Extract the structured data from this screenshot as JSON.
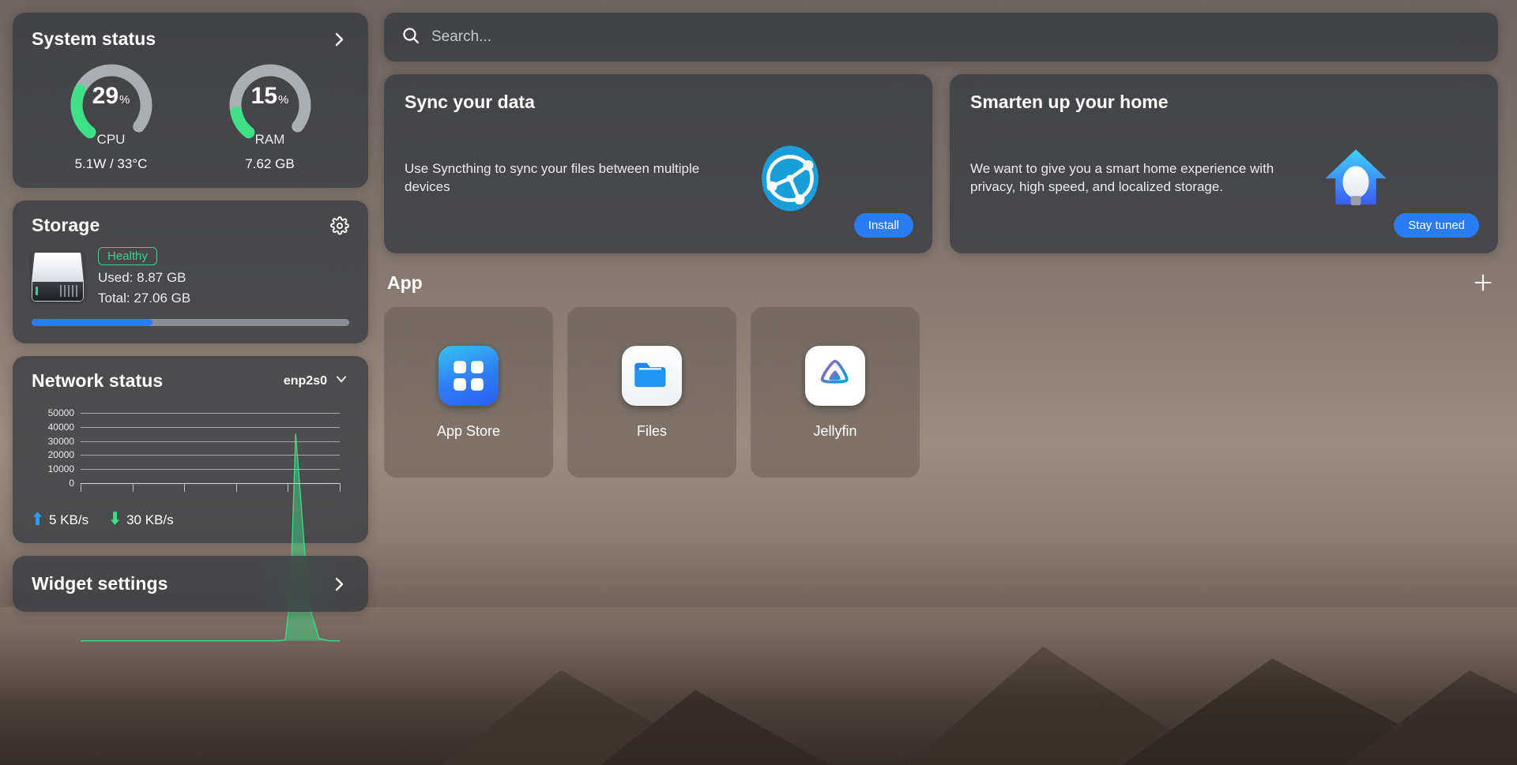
{
  "system_status": {
    "title": "System status",
    "chevron_icon": "chevron-right-icon",
    "cpu": {
      "value": "29",
      "percent_symbol": "%",
      "label": "CPU",
      "sub": "5.1W / 33°C",
      "percent": 29
    },
    "ram": {
      "value": "15",
      "percent_symbol": "%",
      "label": "RAM",
      "sub": "7.62 GB",
      "percent": 15
    },
    "gauge_color": "#3ee08a",
    "gauge_track_color": "#a9aeb3"
  },
  "storage": {
    "title": "Storage",
    "gear_icon": "gear-icon",
    "disk_icon": "hard-disk-icon",
    "status_badge": "Healthy",
    "used_label": "Used: 8.87 GB",
    "total_label": "Total: 27.06 GB",
    "used_percent": 38,
    "badge_color": "#3ecf8e",
    "bar_color": "#2a7cf5"
  },
  "network": {
    "title": "Network status",
    "interface": "enp2s0",
    "chevron_icon": "chevron-down-icon",
    "upload_icon": "arrow-up-icon",
    "upload_speed": "5 KB/s",
    "download_icon": "arrow-down-icon",
    "download_speed": "30 KB/s",
    "upload_color": "#2a9df5",
    "download_color": "#3ee08a"
  },
  "chart_data": {
    "type": "area",
    "title": "Network status",
    "xlabel": "",
    "ylabel": "",
    "ylim": [
      0,
      55000
    ],
    "yticks": [
      "0",
      "10000",
      "20000",
      "30000",
      "40000",
      "50000"
    ],
    "ytick_values": [
      0,
      10000,
      20000,
      30000,
      40000,
      50000
    ],
    "grid": true,
    "legend": "none",
    "xticks_count": 6,
    "series": [
      {
        "name": "traffic",
        "color": "#3ee08a",
        "x": [
          0,
          10,
          20,
          30,
          40,
          50,
          60,
          70,
          75,
          79,
          81,
          83,
          85,
          88,
          92,
          96,
          100
        ],
        "values": [
          0,
          0,
          0,
          0,
          0,
          0,
          0,
          0,
          0,
          200,
          12000,
          50000,
          34000,
          9000,
          600,
          0,
          0
        ]
      }
    ]
  },
  "widget_settings": {
    "title": "Widget settings",
    "chevron_icon": "chevron-right-icon"
  },
  "search": {
    "icon": "search-icon",
    "placeholder": "Search...",
    "value": ""
  },
  "promos": [
    {
      "title": "Sync your data",
      "text": "Use Syncthing to sync your files between multiple devices",
      "button": "Install",
      "art_icon": "syncthing-logo-icon",
      "button_color": "#2a7cf5"
    },
    {
      "title": "Smarten up your home",
      "text": "We want to give you a smart home experience with privacy, high speed, and localized storage.",
      "button": "Stay tuned",
      "art_icon": "smart-home-bulb-icon",
      "button_color": "#2a7cf5"
    }
  ],
  "app_section": {
    "title": "App",
    "add_icon": "plus-icon",
    "apps": [
      {
        "name": "App Store",
        "icon": "app-store-icon"
      },
      {
        "name": "Files",
        "icon": "files-folder-icon"
      },
      {
        "name": "Jellyfin",
        "icon": "jellyfin-icon"
      }
    ]
  }
}
